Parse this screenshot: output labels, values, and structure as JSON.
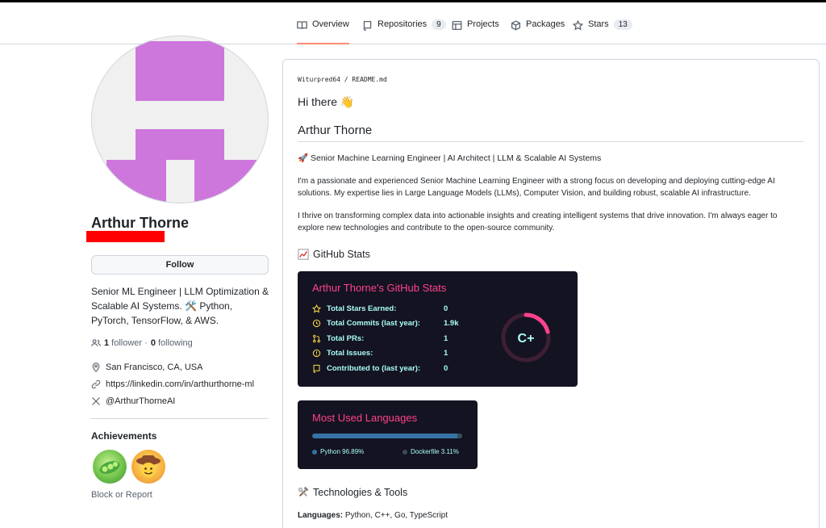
{
  "tabs": [
    {
      "label": "Overview",
      "icon": "book-icon",
      "active": true
    },
    {
      "label": "Repositories",
      "icon": "repo-icon",
      "count": "9"
    },
    {
      "label": "Projects",
      "icon": "table-icon"
    },
    {
      "label": "Packages",
      "icon": "package-icon"
    },
    {
      "label": "Stars",
      "icon": "star-icon",
      "count": "13"
    }
  ],
  "profile": {
    "name": "Arthur Thorne",
    "follow_label": "Follow",
    "bio": "Senior ML Engineer | LLM Optimization & Scalable AI Systems. 🛠️ Python, PyTorch, TensorFlow, & AWS.",
    "followers_count": "1",
    "followers_label": " follower · ",
    "following_count": "0",
    "following_label": " following",
    "location": "San Francisco, CA, USA",
    "link": "https://linkedin.com/in/arthurthorne-ml",
    "x_handle": "@ArthurThorneAI",
    "achievements_title": "Achievements",
    "block_report": "Block or Report",
    "avatar_color": "#cd77dc"
  },
  "readme": {
    "path": "Witurpred64 / README.md",
    "greeting": "Hi there 👋",
    "heading": "Arthur Thorne",
    "tagline": "🚀 Senior Machine Learning Engineer | AI Architect | LLM & Scalable AI Systems",
    "para1": "I'm a passionate and experienced Senior Machine Learning Engineer with a strong focus on developing and deploying cutting-edge AI solutions. My expertise lies in Large Language Models (LLMs), Computer Vision, and building robust, scalable AI infrastructure.",
    "para2": "I thrive on transforming complex data into actionable insights and creating intelligent systems that drive innovation. I'm always eager to explore new technologies and contribute to the open-source community.",
    "stats_heading": "GitHub Stats",
    "tech_heading": "Technologies & Tools",
    "languages_label": "Languages:",
    "languages_value": " Python, C++, Go, TypeScript"
  },
  "stats_card": {
    "title": "Arthur Thorne's GitHub Stats",
    "rows": [
      {
        "label": "Total Stars Earned:",
        "value": "0",
        "icon": "star-icon"
      },
      {
        "label": "Total Commits (last year):",
        "value": "1.9k",
        "icon": "history-icon"
      },
      {
        "label": "Total PRs:",
        "value": "1",
        "icon": "pull-request-icon"
      },
      {
        "label": "Total Issues:",
        "value": "1",
        "icon": "issue-icon"
      },
      {
        "label": "Contributed to (last year):",
        "value": "0",
        "icon": "repo-icon"
      }
    ],
    "grade": "C+",
    "title_color": "#fe428e",
    "text_color": "#a9fef7",
    "icon_color": "#f8d847",
    "bg_color": "#141321"
  },
  "languages_card": {
    "title": "Most Used Languages",
    "items": [
      {
        "name": "Python 96.89%",
        "color": "#3572A5"
      },
      {
        "name": "Dockerfile 3.11%",
        "color": "#384d54"
      }
    ]
  }
}
